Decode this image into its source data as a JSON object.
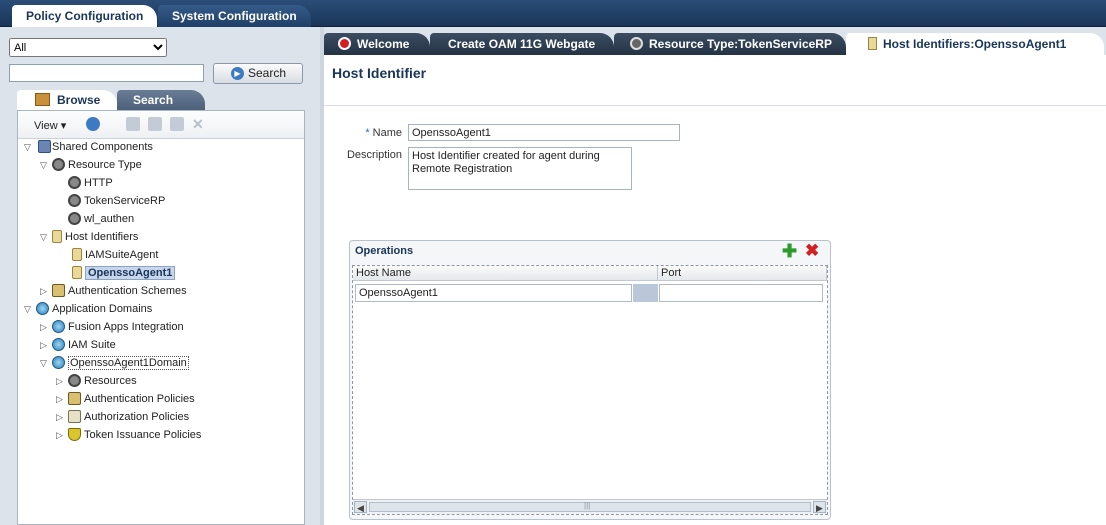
{
  "top_tabs": [
    "Policy Configuration",
    "System Configuration"
  ],
  "left": {
    "scope_select": "All",
    "search_input": "",
    "search_button": "Search",
    "browse_tab": "Browse",
    "search_tab": "Search",
    "view_menu": "View ▾"
  },
  "tree": {
    "shared_components": "Shared Components",
    "resource_type": "Resource Type",
    "http": "HTTP",
    "token_service_rp": "TokenServiceRP",
    "wl_authen": "wl_authen",
    "host_identifiers": "Host Identifiers",
    "iam_suite_agent": "IAMSuiteAgent",
    "opensso_agent1": "OpenssoAgent1",
    "authentication_schemes": "Authentication Schemes",
    "application_domains": "Application Domains",
    "fusion_apps": "Fusion Apps Integration",
    "iam_suite": "IAM Suite",
    "opensso_domain": "OpenssoAgent1Domain",
    "resources": "Resources",
    "authentication_policies": "Authentication Policies",
    "authorization_policies": "Authorization Policies",
    "token_issuance_policies": "Token Issuance Policies"
  },
  "right_tabs": {
    "welcome": "Welcome",
    "create_webgate": "Create OAM 11G Webgate",
    "resource_type": "Resource Type:TokenServiceRP",
    "host_identifiers": "Host Identifiers:OpenssoAgent1"
  },
  "form": {
    "page_title": "Host Identifier",
    "name_required_mark": "*",
    "name_label": "Name",
    "name_value": "OpenssoAgent1",
    "description_label": "Description",
    "description_value": "Host Identifier created for agent during Remote Registration"
  },
  "operations": {
    "title": "Operations",
    "add_symbol": "✚",
    "delete_symbol": "✖",
    "columns": [
      "Host Name",
      "Port"
    ],
    "rows": [
      {
        "host_name": "OpenssoAgent1",
        "port": ""
      }
    ],
    "scroll_grip": "|||"
  }
}
